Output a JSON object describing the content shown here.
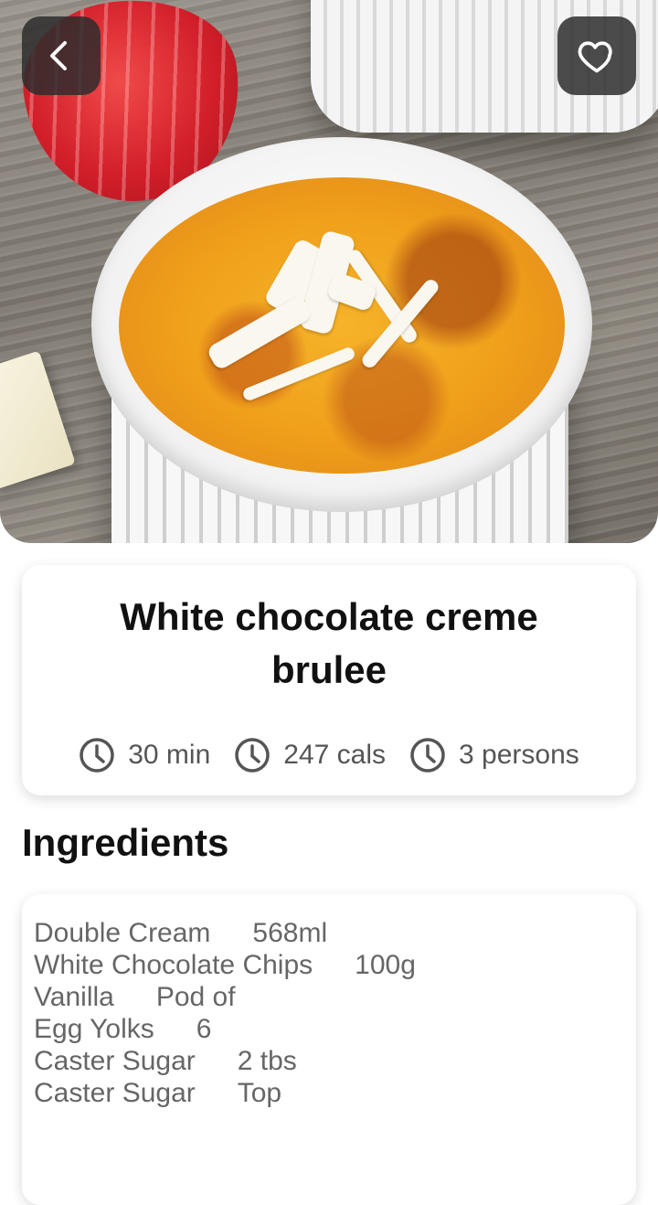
{
  "hero": {
    "image": "white-chocolate-creme-brulee-photo"
  },
  "nav": {
    "back_icon": "chevron-left-icon",
    "favorite_icon": "heart-outline-icon"
  },
  "recipe": {
    "title": "White chocolate creme brulee",
    "meta": [
      {
        "icon": "clock-icon",
        "text": "30 min"
      },
      {
        "icon": "clock-icon",
        "text": "247 cals"
      },
      {
        "icon": "clock-icon",
        "text": "3 persons"
      }
    ]
  },
  "ingredients": {
    "heading": "Ingredients",
    "items": [
      {
        "name": "Double Cream",
        "quantity": "568ml"
      },
      {
        "name": "White Chocolate Chips",
        "quantity": "100g"
      },
      {
        "name": "Vanilla",
        "quantity": "Pod of"
      },
      {
        "name": "Egg Yolks",
        "quantity": "6"
      },
      {
        "name": "Caster Sugar",
        "quantity": "2 tbs"
      },
      {
        "name": "Caster Sugar",
        "quantity": "Top"
      }
    ]
  },
  "colors": {
    "nav_button_bg": "#2d2d2d",
    "text_primary": "#111111",
    "text_secondary": "#555555"
  }
}
